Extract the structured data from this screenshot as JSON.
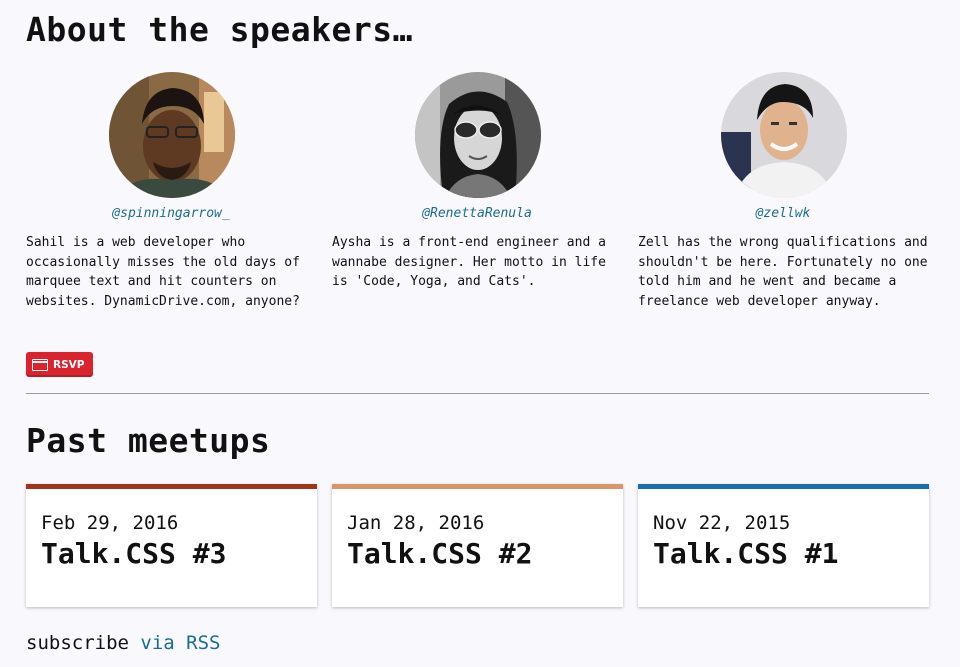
{
  "speakers_section": {
    "heading": "About the speakers…",
    "speakers": [
      {
        "handle": "@spinningarrow_",
        "bio": "Sahil is a web developer who occasionally misses the old days of marquee text and hit counters on websites. DynamicDrive.com, anyone?",
        "avatar": "avatar-photo-sahil"
      },
      {
        "handle": "@RenettaRenula",
        "bio": "Aysha is a front-end engineer and a wannabe designer. Her motto in life is 'Code, Yoga, and Cats'.",
        "avatar": "avatar-photo-aysha"
      },
      {
        "handle": "@zellwk",
        "bio": "Zell has the wrong qualifications and shouldn't be here. Fortunately no one told him and he went and became a freelance web developer anyway.",
        "avatar": "avatar-photo-zell"
      }
    ],
    "rsvp_label": "RSVP",
    "rsvp_icon": "calendar-icon"
  },
  "past_meetups": {
    "heading": "Past meetups",
    "meetups": [
      {
        "date": "Feb 29, 2016",
        "title": "Talk.CSS #3",
        "accent": "#a0341a"
      },
      {
        "date": "Jan 28, 2016",
        "title": "Talk.CSS #2",
        "accent": "#d9966a"
      },
      {
        "date": "Nov 22, 2015",
        "title": "Talk.CSS #1",
        "accent": "#1a6cad"
      }
    ]
  },
  "footer": {
    "subscribe_text": "subscribe",
    "rss_link": "via RSS"
  },
  "colors": {
    "background": "#f9f8fd",
    "link": "#1a6c94",
    "rsvp": "#d9232e"
  }
}
